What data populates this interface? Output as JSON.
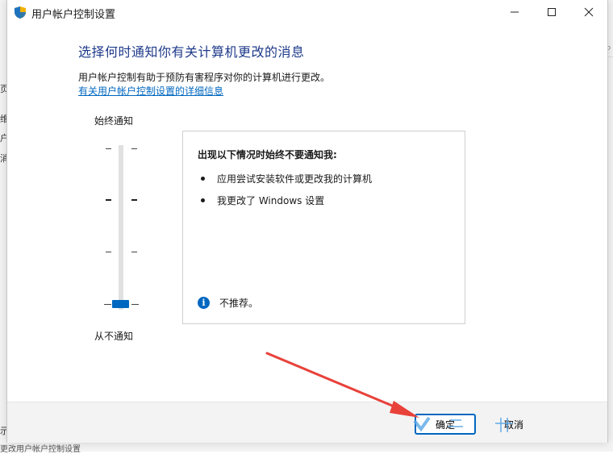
{
  "background": {
    "left_fragments": [
      "页",
      "维",
      "户",
      "消",
      "示"
    ],
    "right_fragment": "⌕",
    "bottom_fragment": "更改用户帐户控制设置"
  },
  "titlebar": {
    "title": "用户帐户控制设置",
    "icon": "shield-icon",
    "buttons": {
      "minimize": "minimize-icon",
      "maximize": "maximize-icon",
      "close": "close-icon"
    }
  },
  "main": {
    "heading": "选择何时通知你有关计算机更改的消息",
    "description": "用户帐户控制有助于预防有害程序对你的计算机进行更改。",
    "link": "有关用户帐户控制设置的详细信息"
  },
  "slider": {
    "top_label": "始终通知",
    "bottom_label": "从不通知",
    "levels": 4,
    "selected_level": 1
  },
  "info_panel": {
    "title": "出现以下情况时始终不要通知我:",
    "bullets": [
      "应用尝试安装软件或更改我的计算机",
      "我更改了 Windows 设置"
    ],
    "note_icon": "info-icon",
    "note": "不推荐。"
  },
  "footer": {
    "ok_label": "确定",
    "cancel_label": "取消"
  },
  "colors": {
    "accent": "#0067c0",
    "heading": "#1e3a8a",
    "annotation": "#e8413a"
  }
}
